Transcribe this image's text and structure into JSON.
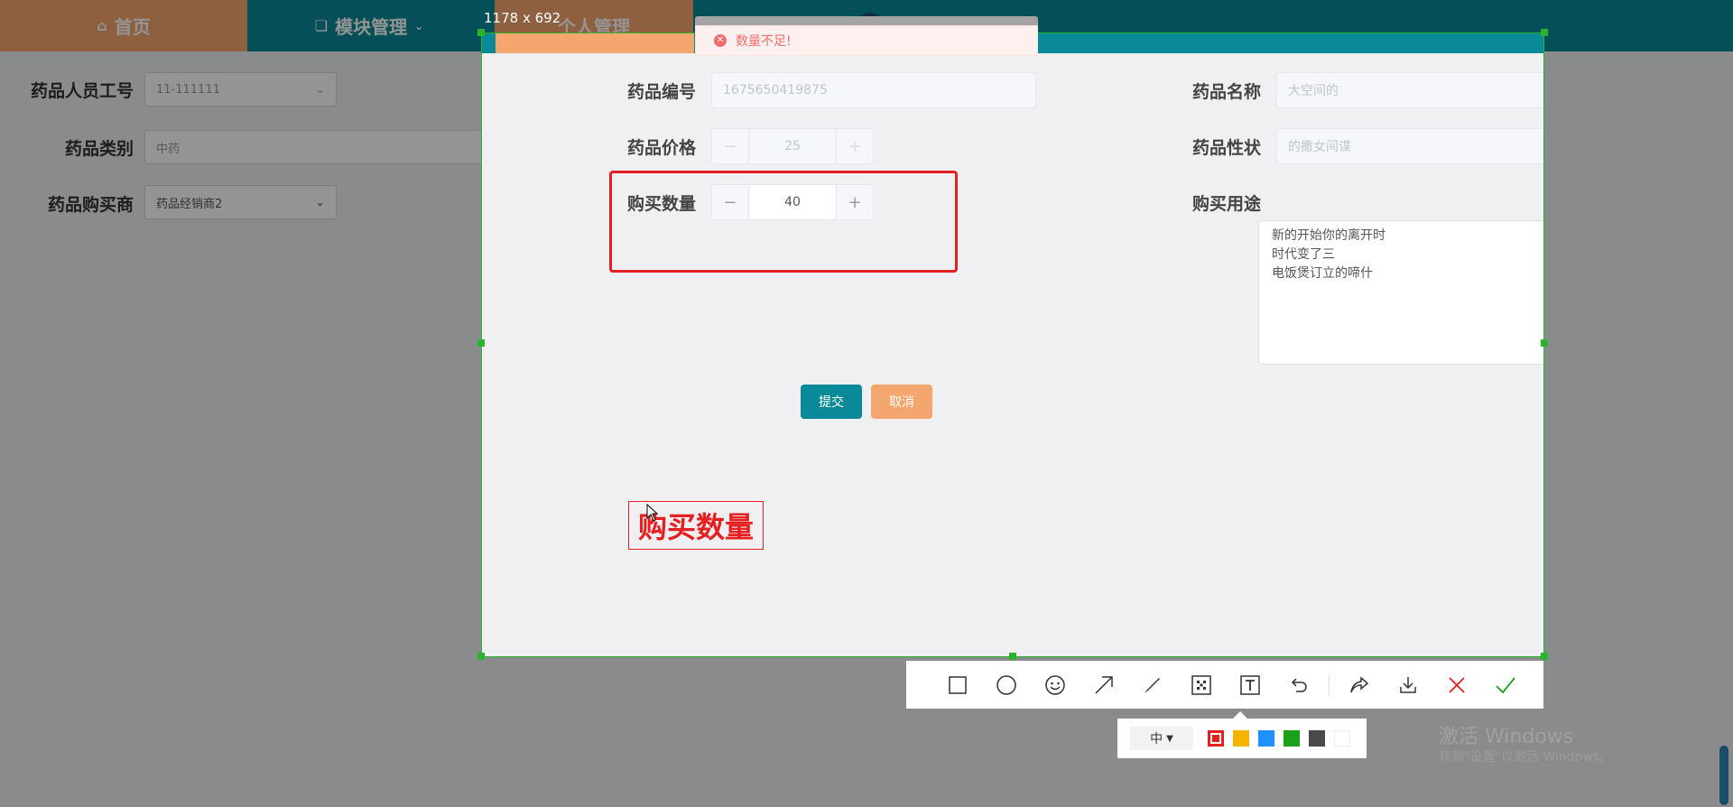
{
  "app": {
    "nav": {
      "home": "首页",
      "module": "模块管理",
      "personal": "个人管理"
    },
    "background_form": {
      "staff_id_label": "药品人员工号",
      "staff_id_value": "11-111111",
      "category_label": "药品类别",
      "category_value": "中药",
      "buyer_label": "药品购买商",
      "buyer_value": "药品经销商2"
    }
  },
  "capture": {
    "size_label": "1178 x 692"
  },
  "message": {
    "text": "数量不足!"
  },
  "form": {
    "code_label": "药品编号",
    "code_value": "1675650419875",
    "name_label": "药品名称",
    "name_value": "大空间的",
    "price_label": "药品价格",
    "price_value": "25",
    "nature_label": "药品性状",
    "nature_value": "的撒女间谍",
    "qty_label": "购买数量",
    "qty_value": "40",
    "purpose_label": "购买用途",
    "purpose_lines": [
      "新的开始你的离开时",
      "时代变了三",
      "电饭煲订立的啼什"
    ],
    "submit": "提交",
    "cancel": "取消"
  },
  "annotation": {
    "text": "购买数量"
  },
  "toolbar": {
    "tools": [
      "rectangle-icon",
      "ellipse-icon",
      "emoji-icon",
      "arrow-icon",
      "pen-icon",
      "mosaic-icon",
      "text-icon",
      "undo-icon",
      "share-icon",
      "download-icon",
      "close-icon",
      "confirm-icon"
    ],
    "font_size": "中",
    "colors": [
      "#e62020",
      "#f5b400",
      "#1e90ff",
      "#1aa01a",
      "#4a4a4a",
      "#ffffff"
    ],
    "selected_color": "#e62020"
  },
  "watermark": {
    "line1": "激活 Windows",
    "line2": "转到\"设置\"以激活 Windows。"
  }
}
